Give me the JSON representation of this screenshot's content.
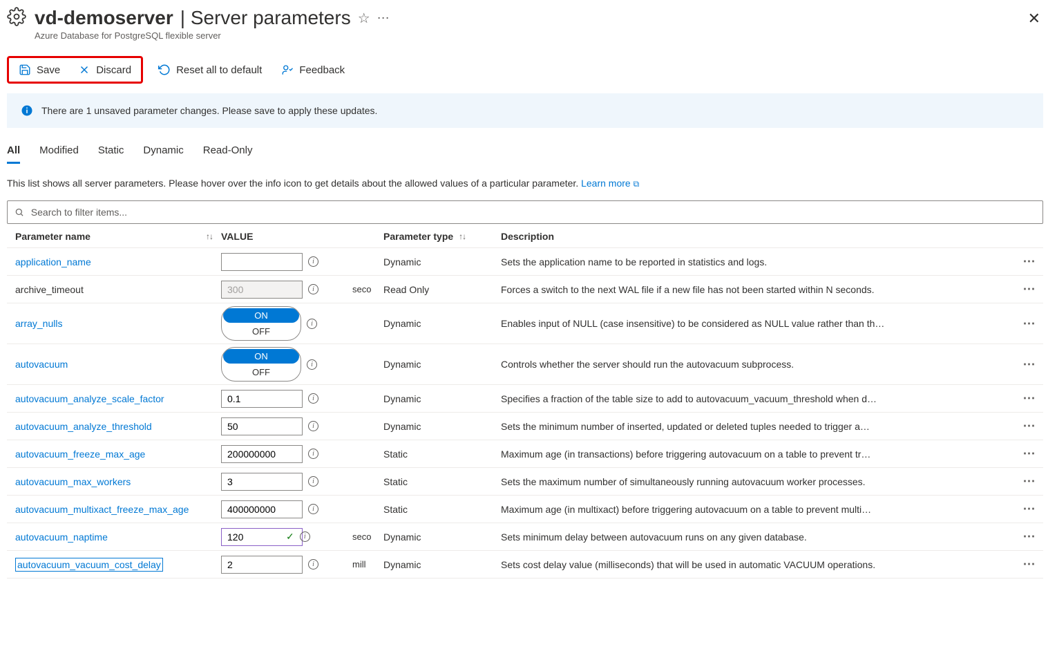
{
  "header": {
    "server_name": "vd-demoserver",
    "page_title": "Server parameters",
    "subtitle": "Azure Database for PostgreSQL flexible server"
  },
  "toolbar": {
    "save": "Save",
    "discard": "Discard",
    "reset": "Reset all to default",
    "feedback": "Feedback"
  },
  "banner": {
    "text": "There are 1 unsaved parameter changes.  Please save to apply these updates."
  },
  "tabs": {
    "all": "All",
    "modified": "Modified",
    "static": "Static",
    "dynamic": "Dynamic",
    "readonly": "Read-Only"
  },
  "description": {
    "text": "This list shows all server parameters. Please hover over the info icon to get details about the allowed values of a particular parameter. ",
    "learn_more": "Learn more"
  },
  "search": {
    "placeholder": "Search to filter items..."
  },
  "columns": {
    "name": "Parameter name",
    "value": "VALUE",
    "type": "Parameter type",
    "desc": "Description"
  },
  "rows": [
    {
      "name": "application_name",
      "link": true,
      "value": "",
      "control": "text",
      "unit": "",
      "type": "Dynamic",
      "desc": "Sets the application name to be reported in statistics and logs."
    },
    {
      "name": "archive_timeout",
      "link": false,
      "value": "300",
      "control": "readonly",
      "unit": "seco",
      "type": "Read Only",
      "desc": "Forces a switch to the next WAL file if a new file has not been started within N seconds."
    },
    {
      "name": "array_nulls",
      "link": true,
      "value": "ON",
      "control": "toggle",
      "unit": "",
      "type": "Dynamic",
      "desc": "Enables input of NULL (case insensitive) to be considered as NULL value rather than th…"
    },
    {
      "name": "autovacuum",
      "link": true,
      "value": "ON",
      "control": "toggle",
      "unit": "",
      "type": "Dynamic",
      "desc": "Controls whether the server should run the autovacuum subprocess."
    },
    {
      "name": "autovacuum_analyze_scale_factor",
      "link": true,
      "value": "0.1",
      "control": "text",
      "unit": "",
      "type": "Dynamic",
      "desc": "Specifies a fraction of the table size to add to autovacuum_vacuum_threshold when d…"
    },
    {
      "name": "autovacuum_analyze_threshold",
      "link": true,
      "value": "50",
      "control": "text",
      "unit": "",
      "type": "Dynamic",
      "desc": "Sets the minimum number of inserted, updated or deleted tuples needed to trigger a…"
    },
    {
      "name": "autovacuum_freeze_max_age",
      "link": true,
      "value": "200000000",
      "control": "text",
      "unit": "",
      "type": "Static",
      "desc": "Maximum age (in transactions) before triggering autovacuum on a table to prevent tr…"
    },
    {
      "name": "autovacuum_max_workers",
      "link": true,
      "value": "3",
      "control": "text",
      "unit": "",
      "type": "Static",
      "desc": "Sets the maximum number of simultaneously running autovacuum worker processes."
    },
    {
      "name": "autovacuum_multixact_freeze_max_age",
      "link": true,
      "value": "400000000",
      "control": "text",
      "unit": "",
      "type": "Static",
      "desc": "Maximum age (in multixact) before triggering autovacuum on a table to prevent multi…"
    },
    {
      "name": "autovacuum_naptime",
      "link": true,
      "value": "120",
      "control": "changed",
      "unit": "seco",
      "type": "Dynamic",
      "desc": "Sets minimum delay between autovacuum runs on any given database."
    },
    {
      "name": "autovacuum_vacuum_cost_delay",
      "link": true,
      "boxed": true,
      "value": "2",
      "control": "text",
      "unit": "mill",
      "type": "Dynamic",
      "desc": "Sets cost delay value (milliseconds) that will be used in automatic VACUUM operations."
    }
  ],
  "toggle_labels": {
    "on": "ON",
    "off": "OFF"
  }
}
